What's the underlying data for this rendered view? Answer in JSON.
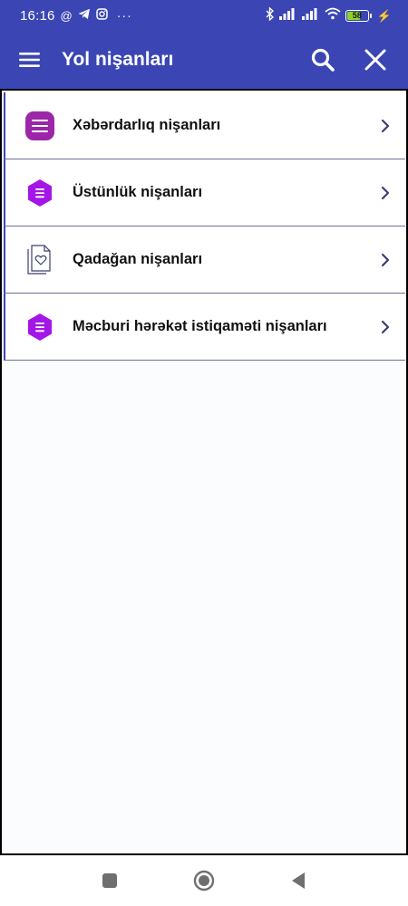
{
  "status_bar": {
    "time": "16:16",
    "left_icons": [
      "at-sign-icon",
      "telegram-icon",
      "instagram-icon",
      "more-dots-icon"
    ],
    "right_icons": [
      "bluetooth-icon",
      "signal-icon",
      "signal-icon",
      "wifi-icon",
      "battery-icon",
      "charging-icon"
    ],
    "battery_level": "58",
    "battery_fraction": 0.58,
    "at_glyph": "@",
    "dots": "···",
    "bolt": "⚡"
  },
  "app_bar": {
    "title": "Yol nişanları",
    "background_color": "#3b46b4"
  },
  "list": {
    "items": [
      {
        "label": "Xəbərdarlıq nişanları",
        "icon": "list-rounded-square-icon",
        "icon_color": "#9b27a8"
      },
      {
        "label": "Üstünlük nişanları",
        "icon": "list-hexagon-icon",
        "icon_color": "#a316e6"
      },
      {
        "label": "Qadağan nişanları",
        "icon": "heart-document-icon",
        "icon_color": "#3b3f6e"
      },
      {
        "label": "Məcburi hərəkət istiqaməti nişanları",
        "icon": "list-hexagon-icon",
        "icon_color": "#a316e6"
      }
    ]
  },
  "nav_bar": {
    "buttons": [
      "recent-apps-icon",
      "home-icon",
      "back-icon"
    ]
  }
}
